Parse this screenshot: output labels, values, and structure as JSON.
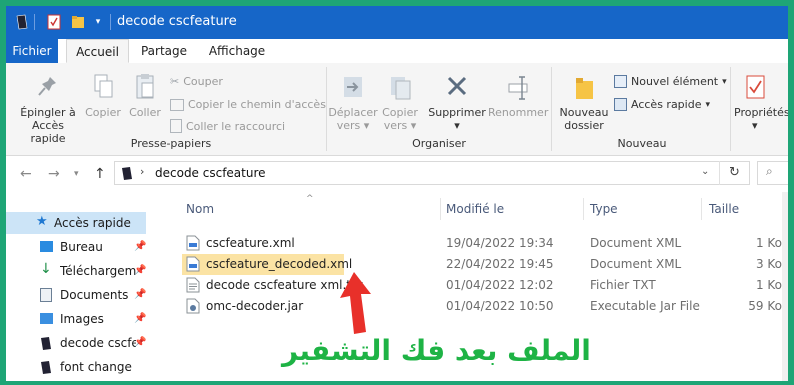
{
  "window": {
    "title": "decode cscfeature"
  },
  "ribbon_tabs": [
    "Fichier",
    "Accueil",
    "Partage",
    "Affichage"
  ],
  "ribbon": {
    "pin_label_1": "Épingler à",
    "pin_label_2": "Accès rapide",
    "copy": "Copier",
    "paste": "Coller",
    "cut": "Couper",
    "copy_path": "Copier le chemin d'accès",
    "paste_shortcut": "Coller le raccourci",
    "group_clipboard": "Presse-papiers",
    "move_1": "Déplacer",
    "move_2": "vers",
    "copyto_1": "Copier",
    "copyto_2": "vers",
    "delete": "Supprimer",
    "rename": "Renommer",
    "group_organize": "Organiser",
    "newfolder_1": "Nouveau",
    "newfolder_2": "dossier",
    "new_item": "Nouvel élément",
    "easy_access": "Accès rapide",
    "group_new": "Nouveau",
    "properties": "Propriétés"
  },
  "address": {
    "path": "decode cscfeature"
  },
  "nav": [
    {
      "label": "Accès rapide",
      "icon": "star-icon"
    },
    {
      "label": "Bureau",
      "icon": "desktop-icon"
    },
    {
      "label": "Téléchargements",
      "icon": "download-icon"
    },
    {
      "label": "Documents",
      "icon": "documents-icon"
    },
    {
      "label": "Images",
      "icon": "images-icon"
    },
    {
      "label": "decode cscfeature",
      "icon": "folder-icon"
    },
    {
      "label": "font change",
      "icon": "folder-icon"
    }
  ],
  "columns": {
    "name": "Nom",
    "modified": "Modifié le",
    "type": "Type",
    "size": "Taille"
  },
  "files": [
    {
      "name": "cscfeature.xml",
      "modified": "19/04/2022 19:34",
      "type": "Document XML",
      "size": "1 Ko"
    },
    {
      "name": "cscfeature_decoded.xml",
      "modified": "22/04/2022 19:45",
      "type": "Document XML",
      "size": "3 Ko"
    },
    {
      "name": "decode cscfeature xml.txt",
      "modified": "01/04/2022 12:02",
      "type": "Fichier TXT",
      "size": "1 Ko"
    },
    {
      "name": "omc-decoder.jar",
      "modified": "01/04/2022 10:50",
      "type": "Executable Jar File",
      "size": "59 Ko"
    }
  ],
  "annotation": {
    "text": "الملف بعد فك التشفير",
    "color": "#1eb345"
  },
  "colors": {
    "accent": "#1666c8",
    "highlight": "#fbe3a4",
    "frame": "#1ea576",
    "arrow": "#e8302a"
  }
}
